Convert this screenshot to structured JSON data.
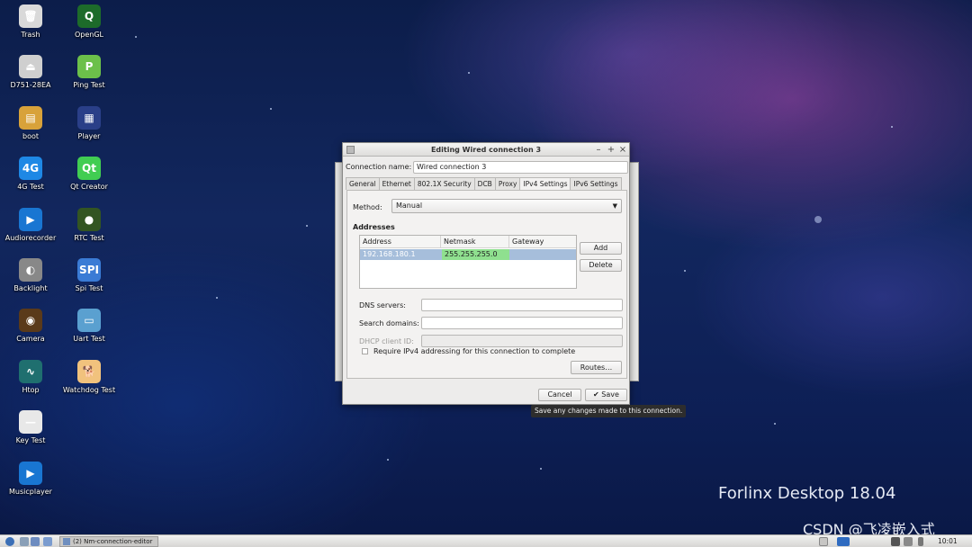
{
  "desktop": {
    "icons_col1": [
      {
        "label": "Trash",
        "icon": "trash-icon",
        "color": "#d9d9d9"
      },
      {
        "label": "D751-28EA",
        "icon": "usb-drive-icon",
        "color": "#cfcfcf"
      },
      {
        "label": "boot",
        "icon": "sd-card-icon",
        "color": "#d8a23a"
      },
      {
        "label": "4G Test",
        "icon": "4g-icon",
        "color": "#1e88e5"
      },
      {
        "label": "Audiorecorder",
        "icon": "play-circle-icon",
        "color": "#1976d2"
      },
      {
        "label": "Backlight",
        "icon": "backlight-icon",
        "color": "#888888"
      },
      {
        "label": "Camera",
        "icon": "camera-icon",
        "color": "#5a3a1a"
      },
      {
        "label": "Htop",
        "icon": "htop-icon",
        "color": "#1f6f6f"
      },
      {
        "label": "Key Test",
        "icon": "key-test-icon",
        "color": "#e8e8e8"
      },
      {
        "label": "Musicplayer",
        "icon": "music-player-icon",
        "color": "#1976d2"
      }
    ],
    "icons_col2": [
      {
        "label": "OpenGL",
        "icon": "opengl-icon",
        "color": "#1d6b2a"
      },
      {
        "label": "Ping Test",
        "icon": "ping-icon",
        "color": "#6cc04a"
      },
      {
        "label": "Player",
        "icon": "player-icon",
        "color": "#2a3f88"
      },
      {
        "label": "Qt Creator",
        "icon": "qt-icon",
        "color": "#41cd52"
      },
      {
        "label": "RTC Test",
        "icon": "rtc-icon",
        "color": "#335522"
      },
      {
        "label": "Spi Test",
        "icon": "spi-icon",
        "color": "#3a7bd5"
      },
      {
        "label": "Uart Test",
        "icon": "uart-icon",
        "color": "#5aa0d0"
      },
      {
        "label": "Watchdog Test",
        "icon": "watchdog-icon",
        "color": "#f1c27d"
      }
    ],
    "icon_glyphs": {
      "trash-icon": "🗑",
      "usb-drive-icon": "⏏",
      "sd-card-icon": "▤",
      "4g-icon": "4G",
      "play-circle-icon": "▶",
      "backlight-icon": "◐",
      "camera-icon": "◉",
      "htop-icon": "∿",
      "key-test-icon": "—",
      "music-player-icon": "▶",
      "opengl-icon": "Q",
      "ping-icon": "P",
      "player-icon": "▦",
      "qt-icon": "Qt",
      "rtc-icon": "●",
      "spi-icon": "SPI",
      "uart-icon": "▭",
      "watchdog-icon": "🐕"
    },
    "brand": "Forlinx Desktop 18.04",
    "watermark": "CSDN @飞凌嵌入式"
  },
  "dialog": {
    "title": "Editing Wired connection 3",
    "connection_name_label": "Connection name:",
    "connection_name_value": "Wired connection 3",
    "tabs": [
      "General",
      "Ethernet",
      "802.1X Security",
      "DCB",
      "Proxy",
      "IPv4 Settings",
      "IPv6 Settings"
    ],
    "active_tab": "IPv4 Settings",
    "method_label": "Method:",
    "method_value": "Manual",
    "addresses_label": "Addresses",
    "columns": [
      "Address",
      "Netmask",
      "Gateway"
    ],
    "rows": [
      {
        "address": "192.168.180.1",
        "netmask": "255.255.255.0",
        "gateway": ""
      }
    ],
    "add_button": "Add",
    "delete_button": "Delete",
    "dns_label": "DNS servers:",
    "dns_value": "",
    "search_label": "Search domains:",
    "search_value": "",
    "dhcp_label": "DHCP client ID:",
    "dhcp_value": "",
    "require_label": "Require IPv4 addressing for this connection to complete",
    "routes_button": "Routes…",
    "cancel_button": "Cancel",
    "save_button": "Save",
    "save_glyph": "✔",
    "tooltip": "Save any changes made to this connection."
  },
  "taskbar": {
    "task_label": "(2) Nm-connection-editor",
    "clock": "10:01"
  }
}
